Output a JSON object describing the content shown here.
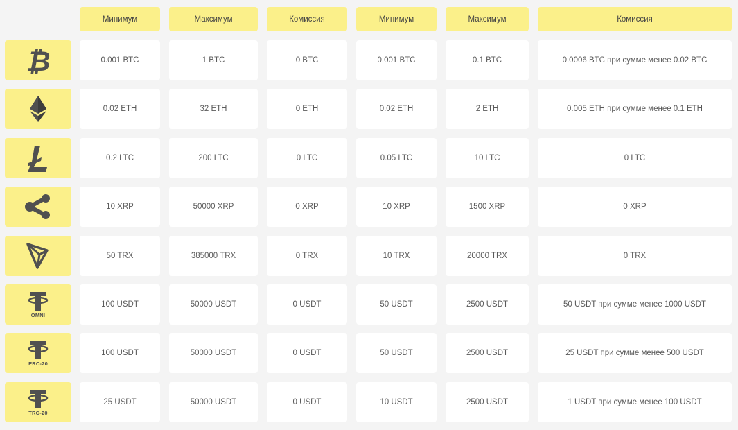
{
  "headers": [
    "Минимум",
    "Максимум",
    "Комиссия",
    "Минимум",
    "Максимум",
    "Комиссия"
  ],
  "rows": [
    {
      "coin": "bitcoin-icon",
      "label": "",
      "cells": [
        "0.001 BTC",
        "1 BTC",
        "0 BTC",
        "0.001 BTC",
        "0.1 BTC",
        "0.0006 BTC при сумме менее 0.02 BTC"
      ]
    },
    {
      "coin": "ethereum-icon",
      "label": "",
      "cells": [
        "0.02 ETH",
        "32 ETH",
        "0 ETH",
        "0.02 ETH",
        "2 ETH",
        "0.005 ETH при сумме менее 0.1 ETH"
      ]
    },
    {
      "coin": "litecoin-icon",
      "label": "",
      "cells": [
        "0.2 LTC",
        "200 LTC",
        "0 LTC",
        "0.05 LTC",
        "10 LTC",
        "0 LTC"
      ]
    },
    {
      "coin": "ripple-icon",
      "label": "",
      "cells": [
        "10 XRP",
        "50000 XRP",
        "0 XRP",
        "10 XRP",
        "1500 XRP",
        "0 XRP"
      ]
    },
    {
      "coin": "tron-icon",
      "label": "",
      "cells": [
        "50 TRX",
        "385000 TRX",
        "0 TRX",
        "10 TRX",
        "20000 TRX",
        "0 TRX"
      ]
    },
    {
      "coin": "tether-icon",
      "label": "OMNI",
      "cells": [
        "100 USDT",
        "50000 USDT",
        "0 USDT",
        "50 USDT",
        "2500 USDT",
        "50 USDT при сумме менее 1000 USDT"
      ]
    },
    {
      "coin": "tether-icon",
      "label": "ERC-20",
      "cells": [
        "100 USDT",
        "50000 USDT",
        "0 USDT",
        "50 USDT",
        "2500 USDT",
        "25 USDT при сумме менее 500 USDT"
      ]
    },
    {
      "coin": "tether-icon",
      "label": "TRC-20",
      "cells": [
        "25 USDT",
        "50000 USDT",
        "0 USDT",
        "10 USDT",
        "2500 USDT",
        "1 USDT при сумме менее 100 USDT"
      ]
    }
  ],
  "colors": {
    "accent": "#fbf08a",
    "cell": "#ffffff",
    "background": "#f4f4f4",
    "icon": "#505050"
  }
}
